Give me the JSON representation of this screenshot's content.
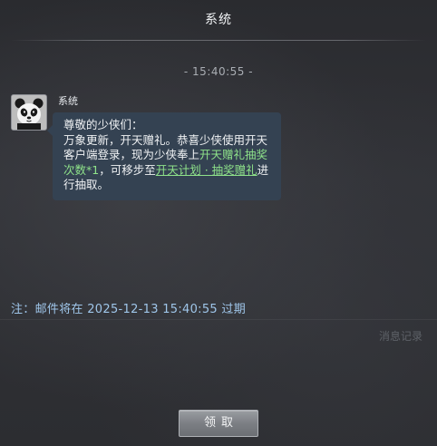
{
  "window": {
    "title": "系统"
  },
  "message": {
    "time": "- 15:40:55 -",
    "sender": "系统",
    "avatar_icon": "panda-avatar-icon",
    "greeting": "尊敬的少侠们：",
    "line1": "万象更新，开天赠礼。恭喜少侠使用开天客户端登录，现为少侠奉上",
    "reward": "开天赠礼抽奖次数*1",
    "mid": "，可移步至",
    "link": "开天计划 · 抽奖赠礼",
    "tail": "进行抽取。"
  },
  "footer": {
    "expiry_notice": "注：邮件将在 2025-12-13 15:40:55 过期",
    "history_label": "消息记录",
    "claim_label": "领取"
  },
  "colors": {
    "highlight": "#8fe38a",
    "expiry_text": "#9fc6ea",
    "bubble_bg": "#344252"
  }
}
